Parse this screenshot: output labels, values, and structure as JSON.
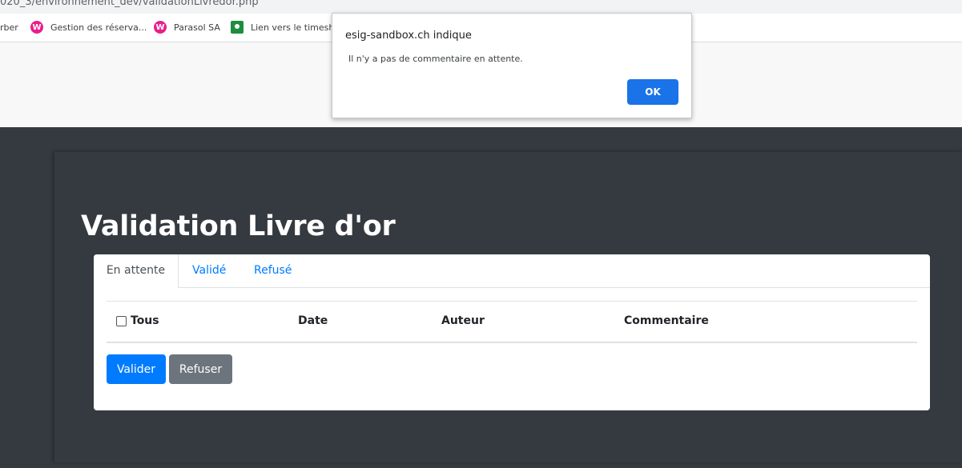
{
  "browser": {
    "url": "020_3/environnement_dev/validationLivredor.php",
    "bookmarks": [
      {
        "label": "rber",
        "icon": "none"
      },
      {
        "label": "Gestion des réserva...",
        "icon": "pink-w-icon"
      },
      {
        "label": "Parasol SA",
        "icon": "pink-w-icon"
      },
      {
        "label": "Lien vers le timeshe",
        "icon": "green-classroom-icon"
      }
    ]
  },
  "page": {
    "title": "Validation Livre d'or",
    "tabs": [
      {
        "label": "En attente",
        "active": true
      },
      {
        "label": "Validé",
        "active": false
      },
      {
        "label": "Refusé",
        "active": false
      }
    ],
    "table": {
      "headers": [
        "Tous",
        "Date",
        "Auteur",
        "Commentaire"
      ]
    },
    "buttons": {
      "validate": "Valider",
      "refuse": "Refuser"
    }
  },
  "dialog": {
    "title": "esig-sandbox.ch indique",
    "message": "Il n'y a pas de commentaire en attente.",
    "ok_label": "OK"
  },
  "colors": {
    "dark_bg": "#343a40",
    "primary": "#007bff",
    "secondary": "#6c757d",
    "dialog_button": "#1a73e8",
    "bookmark_icon_pink": "#e91e8c",
    "bookmark_icon_green": "#1e8e3e"
  }
}
